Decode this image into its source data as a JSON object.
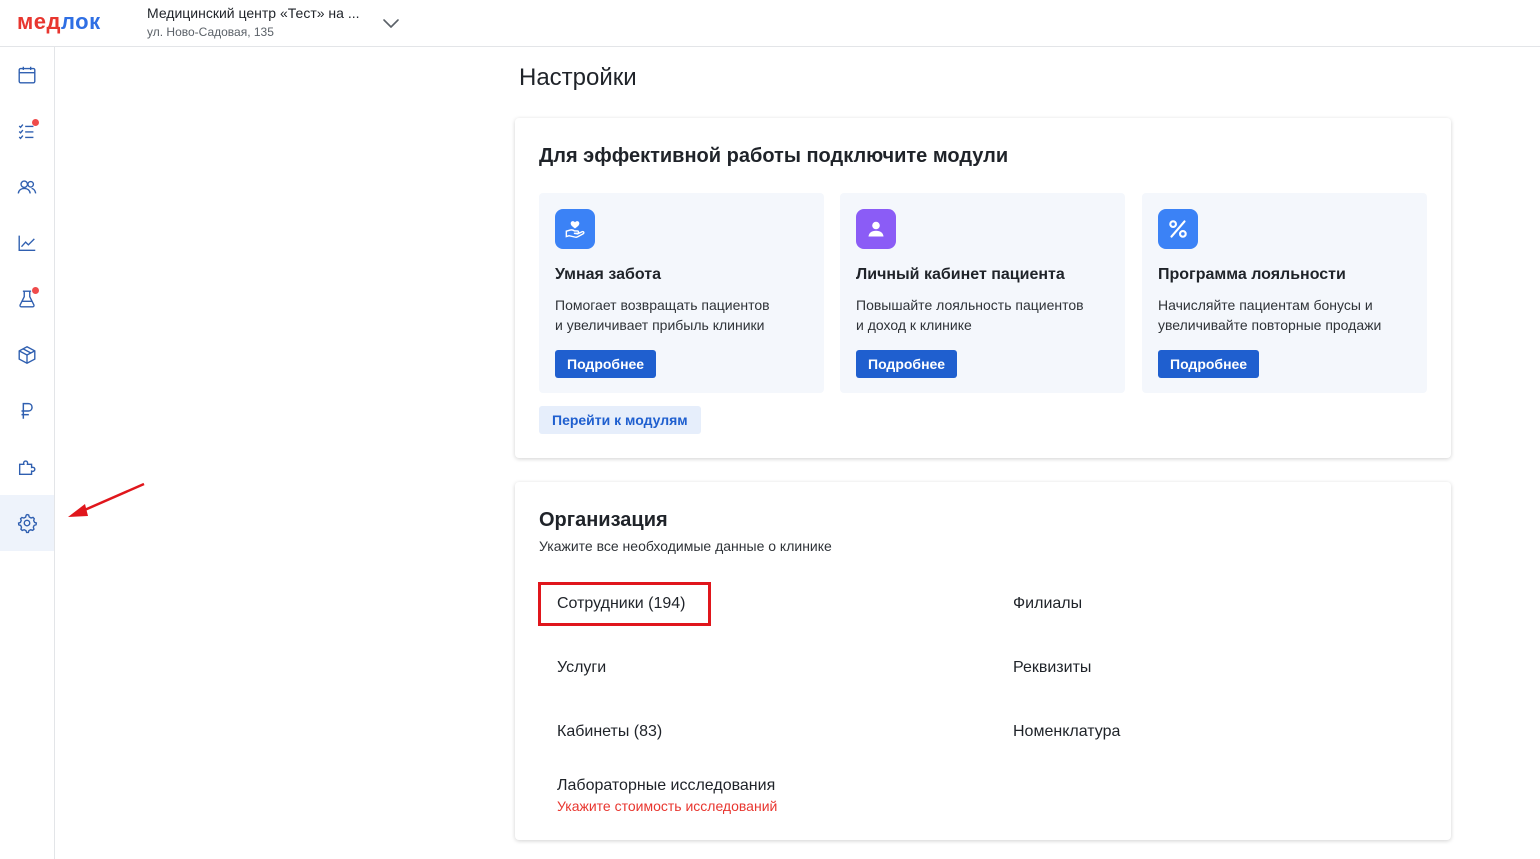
{
  "header": {
    "logo_part1": "мед",
    "logo_part2": "лок",
    "clinic_name": "Медицинский центр «Тест» на ...",
    "clinic_address": "ул. Ново-Садовая, 135"
  },
  "sidebar": {
    "items": [
      {
        "icon": "calendar-icon"
      },
      {
        "icon": "tasks-icon",
        "badge": true
      },
      {
        "icon": "users-icon"
      },
      {
        "icon": "chart-icon"
      },
      {
        "icon": "flask-icon",
        "badge": true
      },
      {
        "icon": "box-icon"
      },
      {
        "icon": "ruble-icon"
      },
      {
        "icon": "puzzle-icon"
      },
      {
        "icon": "gear-icon",
        "active": true
      }
    ]
  },
  "page": {
    "title": "Настройки"
  },
  "modules": {
    "title": "Для эффективной работы подключите модули",
    "items": [
      {
        "title": "Умная забота",
        "desc_line1": "Помогает возвращать пациентов",
        "desc_line2": "и увеличивает прибыль клиники",
        "button": "Подробнее",
        "icon": "heart-hand-icon",
        "color": "#3b82f6"
      },
      {
        "title": "Личный кабинет пациента",
        "desc_line1": "Повышайте лояльность пациентов",
        "desc_line2": "и доход к клинике",
        "button": "Подробнее",
        "icon": "person-icon",
        "color": "#8b5cf6"
      },
      {
        "title": "Программа лояльности",
        "desc_line1": "Начисляйте пациентам бонусы и",
        "desc_line2": "увеличивайте повторные продажи",
        "button": "Подробнее",
        "icon": "percent-icon",
        "color": "#3b82f6"
      }
    ],
    "goto_label": "Перейти к модулям"
  },
  "organization": {
    "title": "Организация",
    "subtitle": "Укажите все необходимые данные о клинике",
    "links": {
      "employees": "Сотрудники (194)",
      "branches": "Филиалы",
      "services": "Услуги",
      "requisites": "Реквизиты",
      "rooms": "Кабинеты (83)",
      "nomenclature": "Номенклатура",
      "lab": "Лабораторные исследования"
    },
    "lab_warning": "Укажите стоимость исследований"
  },
  "colors": {
    "accent": "#1f5fcf",
    "brand_red": "#e8362f",
    "brand_blue": "#2f6fe4",
    "annotation": "#e0161c"
  }
}
